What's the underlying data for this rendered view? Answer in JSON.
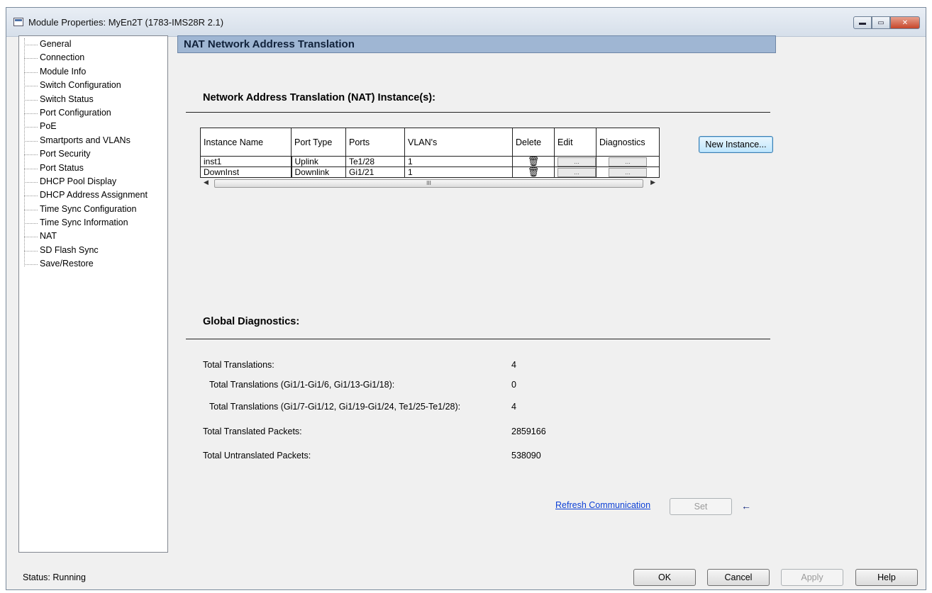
{
  "window": {
    "title": "Module Properties: MyEn2T (1783-IMS28R 2.1)",
    "controls": {
      "minimize": "▬",
      "maximize": "▭",
      "close": "✕"
    }
  },
  "sidebar": {
    "items": [
      {
        "label": "General"
      },
      {
        "label": "Connection"
      },
      {
        "label": "Module Info"
      },
      {
        "label": "Switch Configuration"
      },
      {
        "label": "Switch Status"
      },
      {
        "label": "Port Configuration"
      },
      {
        "label": "PoE"
      },
      {
        "label": "Smartports and VLANs"
      },
      {
        "label": "Port Security"
      },
      {
        "label": "Port Status"
      },
      {
        "label": "DHCP Pool Display"
      },
      {
        "label": "DHCP Address Assignment"
      },
      {
        "label": "Time Sync Configuration"
      },
      {
        "label": "Time Sync Information"
      },
      {
        "label": "NAT"
      },
      {
        "label": "SD Flash Sync"
      },
      {
        "label": "Save/Restore"
      }
    ]
  },
  "main": {
    "header": "NAT Network Address Translation",
    "instances_title": "Network Address Translation (NAT) Instance(s):",
    "table": {
      "columns": [
        "Instance Name",
        "Port Type",
        "Ports",
        "VLAN's",
        "Delete",
        "Edit",
        "Diagnostics"
      ],
      "rows": [
        {
          "name": "inst1",
          "port_type": "Uplink",
          "ports": "Te1/28",
          "vlans": "1",
          "edit": "...",
          "diag": "..."
        },
        {
          "name": "DownInst",
          "port_type": "Downlink",
          "ports": "Gi1/21",
          "vlans": "1",
          "edit": "...",
          "diag": "..."
        }
      ],
      "scroll_grip": "III"
    },
    "new_instance_label": "New Instance...",
    "global_title": "Global Diagnostics:",
    "diagnostics": {
      "total_translations": {
        "label": "Total Translations:",
        "value": "4"
      },
      "total_translations_a": {
        "label": "Total Translations (Gi1/1-Gi1/6, Gi1/13-Gi1/18):",
        "value": "0"
      },
      "total_translations_b": {
        "label": "Total Translations (Gi1/7-Gi1/12, Gi1/19-Gi1/24, Te1/25-Te1/28):",
        "value": "4"
      },
      "translated_packets": {
        "label": "Total Translated Packets:",
        "value": "2859166"
      },
      "untranslated_packets": {
        "label": "Total Untranslated Packets:",
        "value": "538090"
      }
    },
    "refresh_link": "Refresh Communication",
    "set_label": "Set",
    "back_arrow": "←"
  },
  "footer": {
    "status": "Status:  Running",
    "ok": "OK",
    "cancel": "Cancel",
    "apply": "Apply",
    "help": "Help"
  },
  "colors": {
    "header_bar": "#9fb6d3",
    "link": "#0b3fd6",
    "window_bg": "#f0f0f0"
  }
}
